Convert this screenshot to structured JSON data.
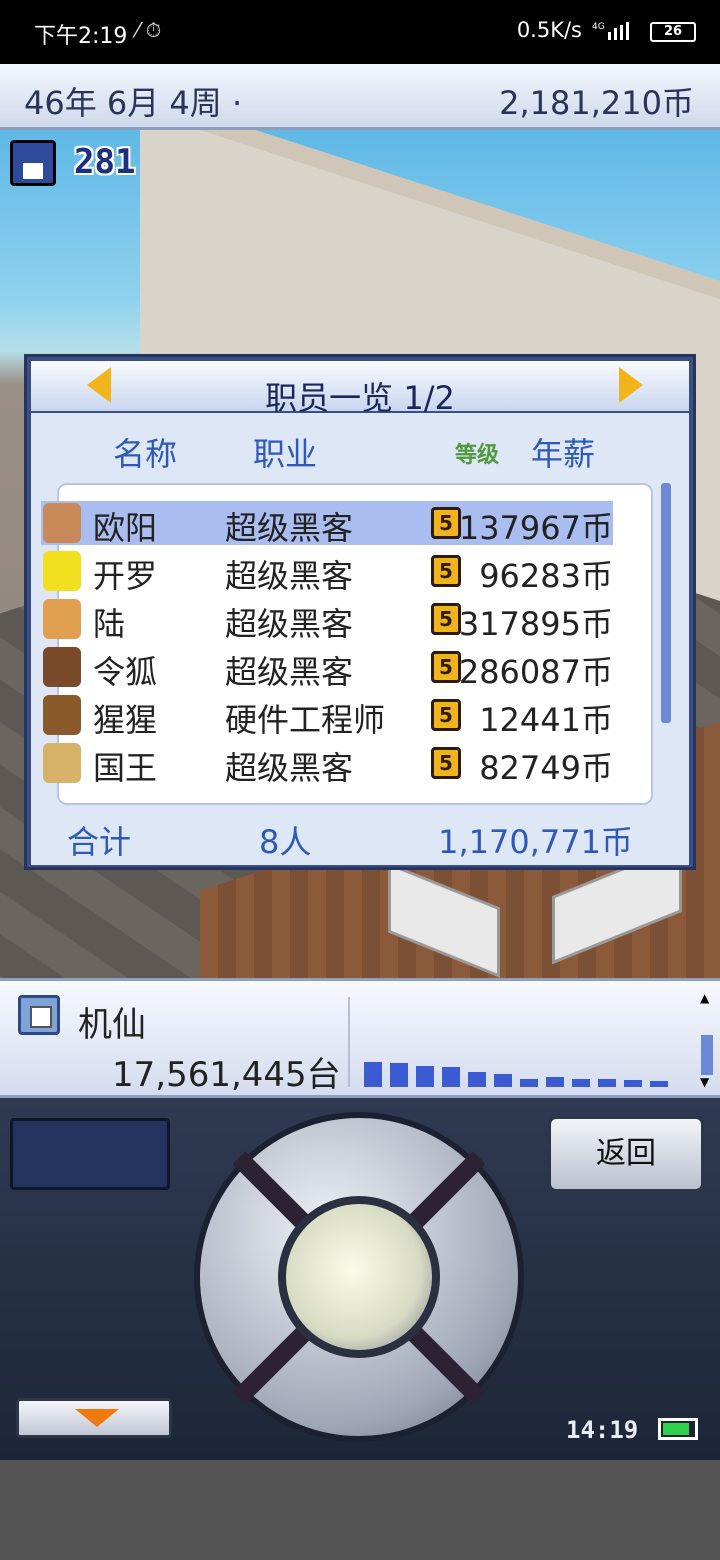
{
  "status_bar": {
    "time": "下午2:19",
    "net_speed": "0.5K/s",
    "network": "4G",
    "battery": "26"
  },
  "game_header": {
    "date": "46年 6月 4周 ·",
    "funds": "2,181,210币"
  },
  "save_count": "281",
  "staff_dialog": {
    "title": "职员一览 1/2",
    "col_name": "名称",
    "col_job": "职业",
    "col_level": "等级",
    "col_salary": "年薪",
    "rows": [
      {
        "name": "欧阳",
        "job": "超级黑客",
        "level": "5",
        "salary": "137967币",
        "avatar_color": "#c98a5a"
      },
      {
        "name": "开罗",
        "job": "超级黑客",
        "level": "5",
        "salary": "96283币",
        "avatar_color": "#f0e020"
      },
      {
        "name": "陆",
        "job": "超级黑客",
        "level": "5",
        "salary": "317895币",
        "avatar_color": "#e0a050"
      },
      {
        "name": "令狐",
        "job": "超级黑客",
        "level": "5",
        "salary": "286087币",
        "avatar_color": "#7a4a2a"
      },
      {
        "name": "猩猩",
        "job": "硬件工程师",
        "level": "5",
        "salary": "12441币",
        "avatar_color": "#8a5a2a"
      },
      {
        "name": "国王",
        "job": "超级黑客",
        "level": "5",
        "salary": "82749币",
        "avatar_color": "#d9b26a"
      }
    ],
    "total_label": "合计",
    "total_count": "8人",
    "total_salary": "1,170,771币"
  },
  "product_info": {
    "name": "机仙",
    "units_sold": "17,561,445台",
    "sales_levels": [
      0.9,
      0.85,
      0.75,
      0.7,
      0.55,
      0.45,
      0.3,
      0.35,
      0.3,
      0.28,
      0.25,
      0.2
    ]
  },
  "console": {
    "back_label": "返回",
    "clock": "14:19",
    "battery_level": 0.85
  }
}
